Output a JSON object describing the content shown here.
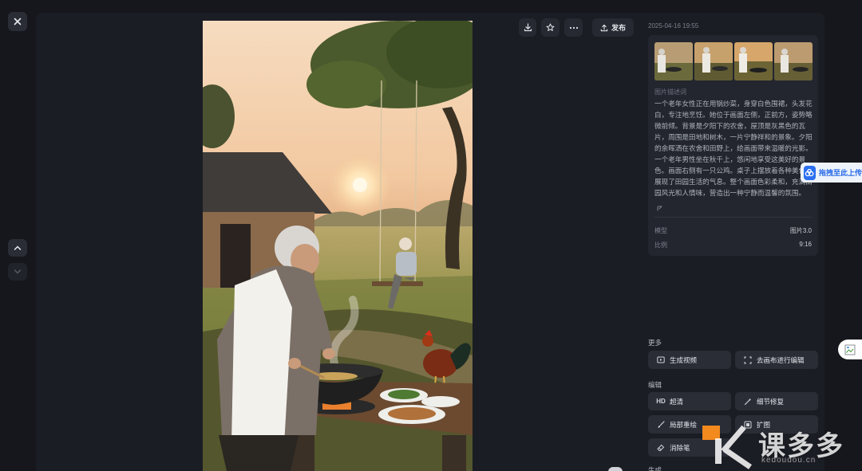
{
  "toolbar": {
    "publish_label": "发布"
  },
  "info": {
    "timestamp": "2025-04-16 19:55",
    "description_label": "图片描述词",
    "description": "一个老年女性正在用锅炒菜，身穿白色围裙，头发花白，专注地烹饪。她位于画面左侧，正前方，姿势略微前倾。背景是夕阳下的农舍，屋顶是灰黑色的瓦片，周围是田地和树木，一片宁静祥和的景象。夕阳的余晖洒在农舍和田野上，给画面带来温暖的光影。一个老年男性坐在秋千上，悠闲地享受这美好的景色。画面右侧有一只公鸡。桌子上摆放着各种美食，展现了田园生活的气息。整个画面色彩柔和，充满田园风光和人情味，营造出一种宁静而温馨的氛围。",
    "model_label": "模型",
    "model_value": "图片3.0",
    "ratio_label": "比例",
    "ratio_value": "9:16"
  },
  "side_tool": {
    "drag_label": "拖拽至此上传"
  },
  "sections": {
    "more": "更多",
    "edit": "编辑",
    "generate": "生成"
  },
  "actions": {
    "generate_video": "生成视频",
    "canvas_edit": "去画布进行编辑",
    "hd_icon_text": "HD",
    "hd": "超清",
    "detail_repair": "细节修复",
    "partial_redraw": "局部重绘",
    "expand": "扩图",
    "eraser": "消除笔"
  },
  "watermark": {
    "text": "课多多",
    "sub": "kedoudou.cn"
  },
  "colors": {
    "background": "#15171d",
    "stage": "#1b1d24",
    "card": "#23262e",
    "button": "#2a2d36",
    "accent_blue": "#2b6ff0",
    "watermark_orange": "#f28a1e"
  }
}
